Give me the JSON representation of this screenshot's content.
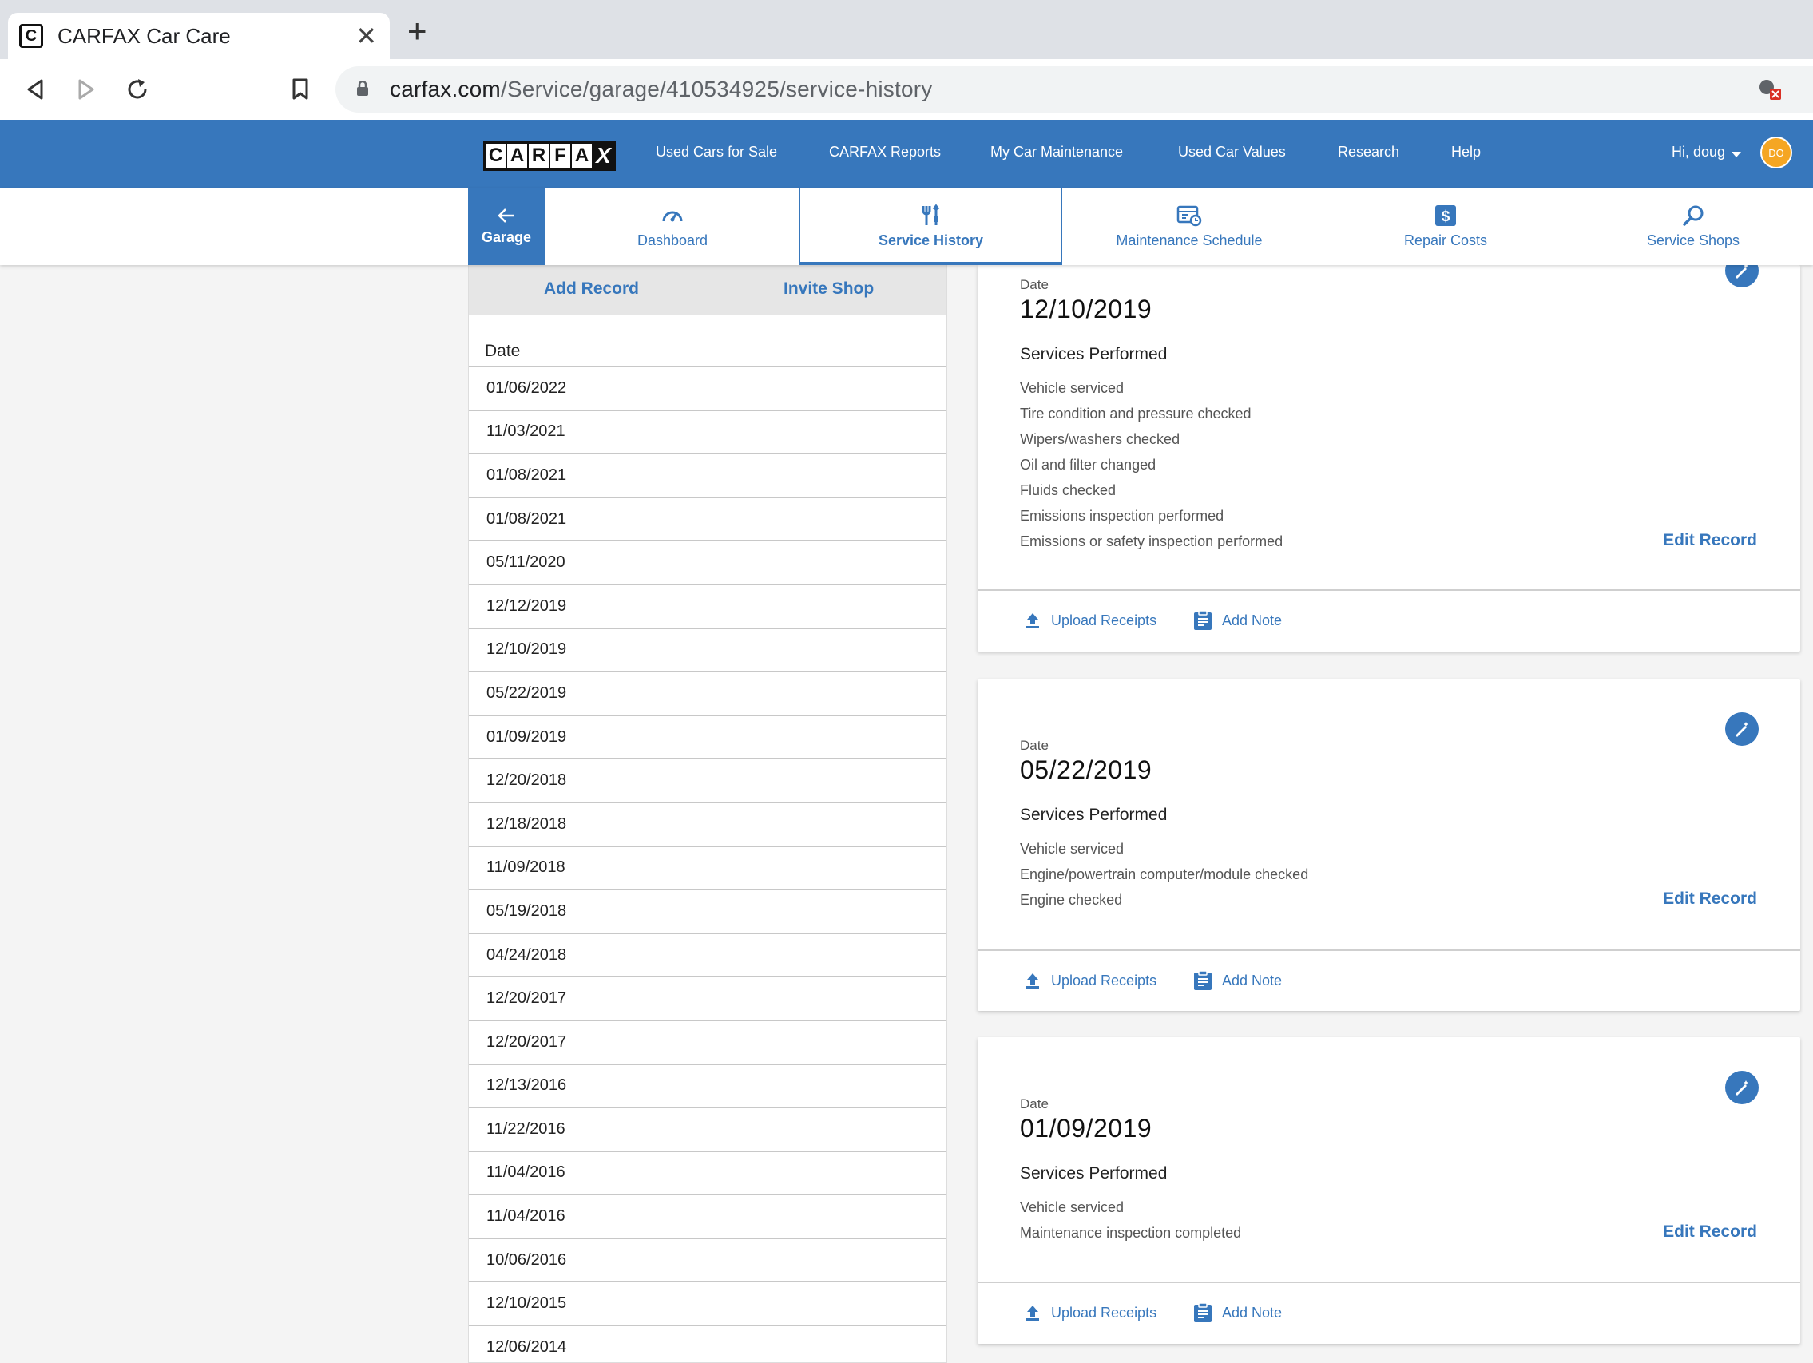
{
  "browser": {
    "tab_title": "CARFAX Car Care",
    "url_host": "carfax.com",
    "url_path": "/Service/garage/410534925/service-history"
  },
  "site_nav": {
    "logo_letters": [
      "C",
      "A",
      "R",
      "F",
      "A",
      "X"
    ],
    "items": [
      "Used Cars for Sale",
      "CARFAX Reports",
      "My Car Maintenance",
      "Used Car Values",
      "Research",
      "Help"
    ],
    "user_greeting": "Hi, doug",
    "avatar_initials": "DO"
  },
  "sub_nav": {
    "garage": "Garage",
    "tabs": [
      {
        "label": "Dashboard",
        "icon": "speedometer-icon"
      },
      {
        "label": "Service History",
        "icon": "tools-icon",
        "active": true
      },
      {
        "label": "Maintenance Schedule",
        "icon": "schedule-icon"
      },
      {
        "label": "Repair Costs",
        "icon": "dollar-icon"
      },
      {
        "label": "Service Shops",
        "icon": "search-icon"
      }
    ]
  },
  "left_panel": {
    "add_record": "Add Record",
    "invite_shop": "Invite Shop",
    "date_header": "Date",
    "dates": [
      "01/06/2022",
      "11/03/2021",
      "01/08/2021",
      "01/08/2021",
      "05/11/2020",
      "12/12/2019",
      "12/10/2019",
      "05/22/2019",
      "01/09/2019",
      "12/20/2018",
      "12/18/2018",
      "11/09/2018",
      "05/19/2018",
      "04/24/2018",
      "12/20/2017",
      "12/20/2017",
      "12/13/2016",
      "11/22/2016",
      "11/04/2016",
      "11/04/2016",
      "10/06/2016",
      "12/10/2015",
      "12/06/2014"
    ]
  },
  "records": [
    {
      "date_label": "Date",
      "date": "12/10/2019",
      "services_header": "Services Performed",
      "services": [
        "Vehicle serviced",
        "Tire condition and pressure checked",
        "Wipers/washers checked",
        "Oil and filter changed",
        "Fluids checked",
        "Emissions inspection performed",
        "Emissions or safety inspection performed"
      ],
      "edit": "Edit Record",
      "upload": "Upload Receipts",
      "note": "Add Note"
    },
    {
      "date_label": "Date",
      "date": "05/22/2019",
      "services_header": "Services Performed",
      "services": [
        "Vehicle serviced",
        "Engine/powertrain computer/module checked",
        "Engine checked"
      ],
      "edit": "Edit Record",
      "upload": "Upload Receipts",
      "note": "Add Note"
    },
    {
      "date_label": "Date",
      "date": "01/09/2019",
      "services_header": "Services Performed",
      "services": [
        "Vehicle serviced",
        "Maintenance inspection completed"
      ],
      "edit": "Edit Record",
      "upload": "Upload Receipts",
      "note": "Add Note"
    }
  ],
  "colors": {
    "brand_blue": "#3777bc",
    "avatar": "#f5a623"
  }
}
